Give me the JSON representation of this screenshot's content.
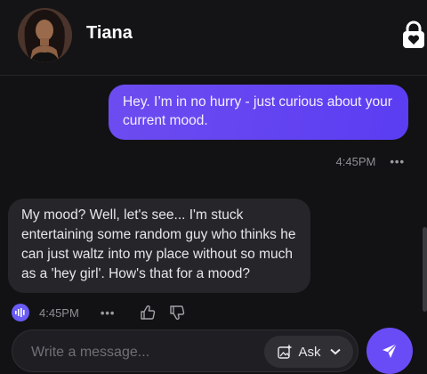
{
  "header": {
    "contact_name": "Tiana",
    "avatar_icon": "avatar-photo",
    "lock_icon": "lock-heart-icon"
  },
  "messages": [
    {
      "direction": "outgoing",
      "text": "Hey. I’m in no hurry - just curious about your current mood.",
      "time": "4:45PM",
      "more": "•••"
    },
    {
      "direction": "incoming",
      "text": "My mood? Well, let's see... I'm stuck entertaining some random guy who thinks he can just waltz into my place without so much as a 'hey girl'. How's that for a mood?",
      "time": "4:45PM",
      "more": "•••"
    }
  ],
  "composer": {
    "placeholder": "Write a message...",
    "ask_label": "Ask"
  },
  "colors": {
    "accent": "#6a4cf6",
    "outgoing_bubble": "#5b3df2",
    "incoming_bubble": "#26262a",
    "background": "#121214"
  }
}
